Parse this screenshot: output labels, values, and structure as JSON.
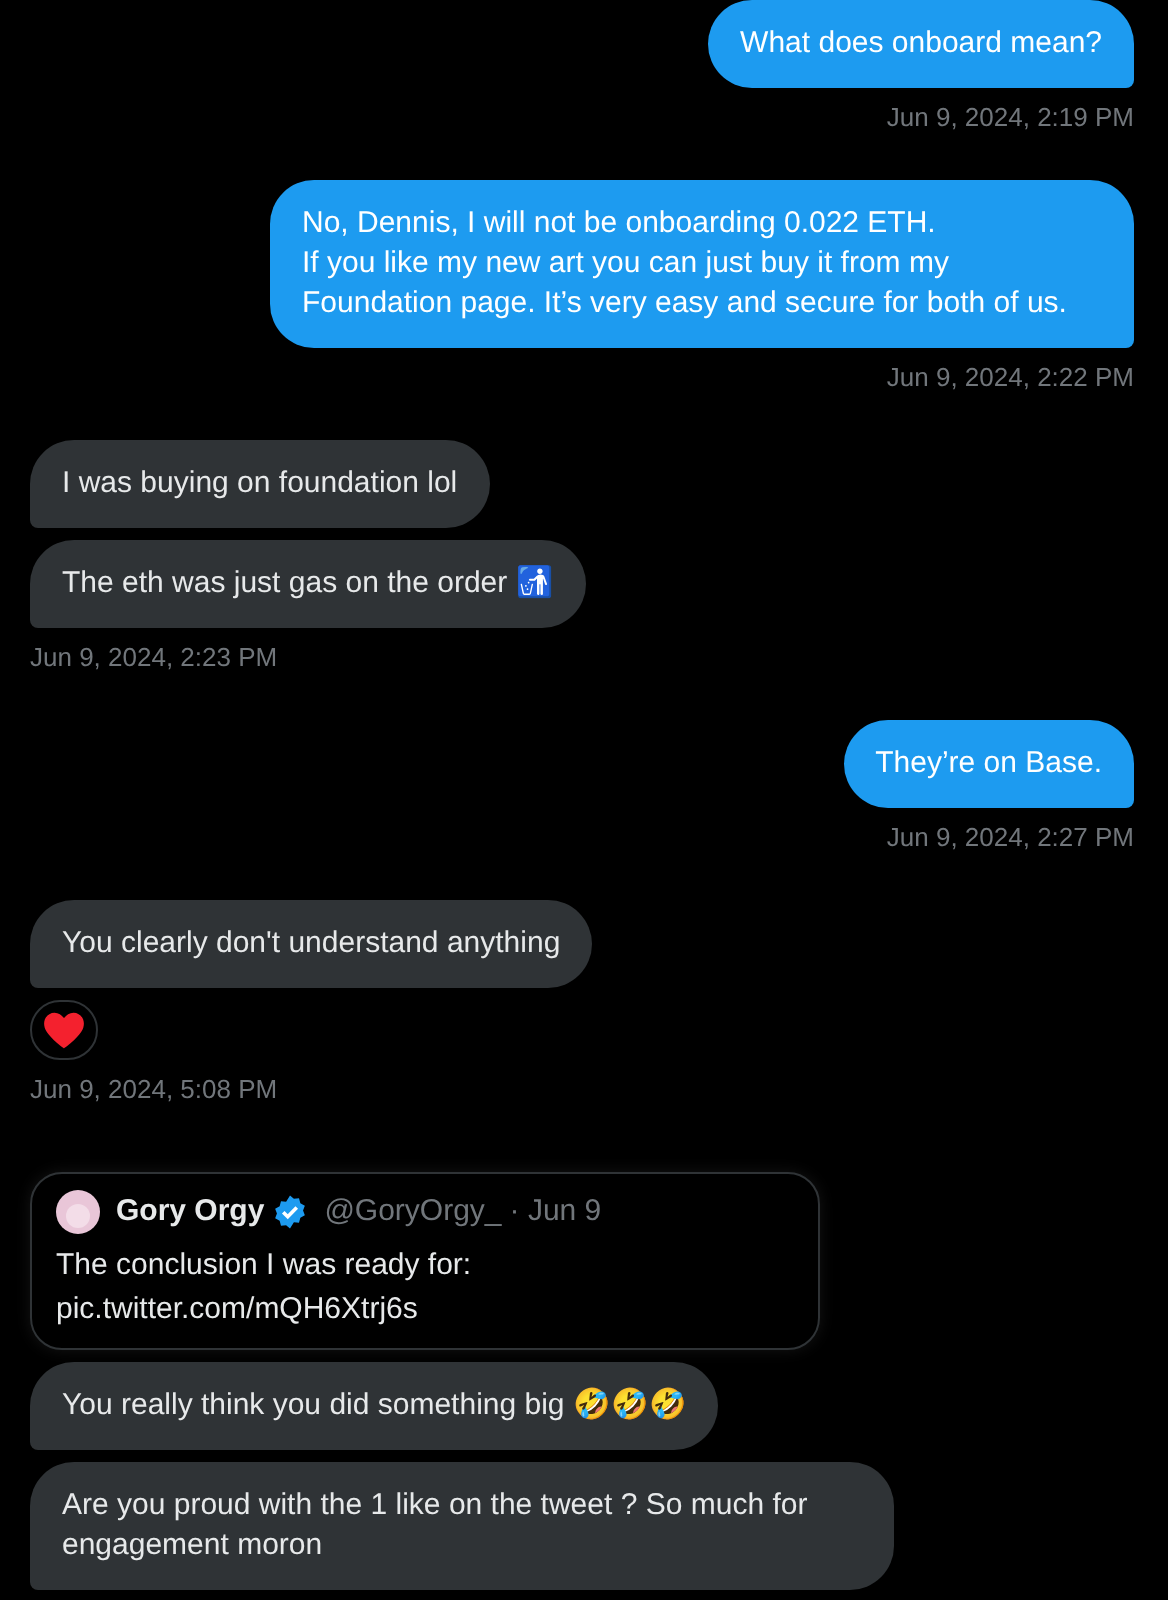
{
  "groups": [
    {
      "kind": "sent",
      "messages": [
        {
          "kind": "text",
          "text": "What does onboard mean?"
        }
      ],
      "time": "Jun 9, 2024, 2:19 PM"
    },
    {
      "kind": "sent",
      "messages": [
        {
          "kind": "text",
          "text": "No, Dennis, I will not be onboarding 0.022 ETH.\nIf you like my new art you can just buy it from my Foundation page. It’s very easy and secure for both of us."
        }
      ],
      "time": "Jun 9, 2024, 2:22 PM"
    },
    {
      "kind": "received",
      "messages": [
        {
          "kind": "text",
          "text": "I was buying on foundation lol"
        },
        {
          "kind": "text",
          "text": "The eth was just gas on the order 🚮"
        }
      ],
      "time": "Jun 9, 2024, 2:23 PM"
    },
    {
      "kind": "sent",
      "messages": [
        {
          "kind": "text",
          "text": "They’re on Base."
        }
      ],
      "time": "Jun 9, 2024, 2:27 PM"
    },
    {
      "kind": "received",
      "messages": [
        {
          "kind": "text",
          "text": "You clearly don't understand anything",
          "reaction": true
        }
      ],
      "time": "Jun 9, 2024, 5:08 PM"
    },
    {
      "kind": "received",
      "messages": [
        {
          "kind": "quote",
          "author": "Gory Orgy",
          "verified": true,
          "handle": "@GoryOrgy_",
          "date": "· Jun 9",
          "text": "The conclusion I was ready for:",
          "link": "pic.twitter.com/mQH6Xtrj6s"
        },
        {
          "kind": "text",
          "text": "You really think you did something big 🤣🤣🤣"
        },
        {
          "kind": "text",
          "text": "Are you proud with the 1 like on the tweet ? So much for engagement moron"
        }
      ]
    }
  ]
}
